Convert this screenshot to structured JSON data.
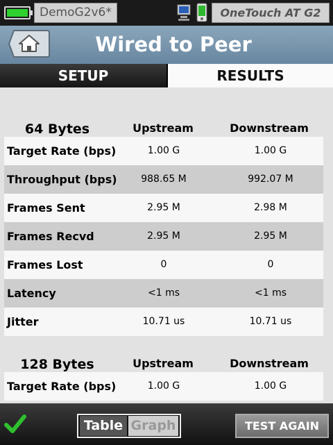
{
  "status": {
    "profile": "DemoG2v6*",
    "product": "OneTouch AT G2",
    "battery_color": "#2fd12f",
    "icons": [
      "battery-icon",
      "remote-pc-icon",
      "mobile-device-icon"
    ]
  },
  "header": {
    "title": "Wired to Peer",
    "home_icon": "home-icon"
  },
  "tabs": [
    {
      "label": "SETUP",
      "active": false
    },
    {
      "label": "RESULTS",
      "active": true
    }
  ],
  "sections": [
    {
      "size": "64 Bytes",
      "col_up": "Upstream",
      "col_down": "Downstream",
      "rows": [
        {
          "label": "Target Rate (bps)",
          "up": "1.00 G",
          "down": "1.00 G"
        },
        {
          "label": "Throughput (bps)",
          "up": "988.65 M",
          "down": "992.07 M"
        },
        {
          "label": "Frames Sent",
          "up": "2.95 M",
          "down": "2.98 M"
        },
        {
          "label": "Frames Recvd",
          "up": "2.95 M",
          "down": "2.95 M"
        },
        {
          "label": "Frames Lost",
          "up": "0",
          "down": "0"
        },
        {
          "label": "Latency",
          "up": "<1 ms",
          "down": "<1 ms"
        },
        {
          "label": "Jitter",
          "up": "10.71 us",
          "down": "10.71 us"
        }
      ]
    },
    {
      "size": "128 Bytes",
      "col_up": "Upstream",
      "col_down": "Downstream",
      "rows": [
        {
          "label": "Target Rate (bps)",
          "up": "1.00 G",
          "down": "1.00 G"
        }
      ]
    }
  ],
  "footer": {
    "status_icon": "checkmark-icon",
    "view_table": "Table",
    "view_graph": "Graph",
    "selected_view": "Table",
    "test_again": "TEST AGAIN"
  }
}
